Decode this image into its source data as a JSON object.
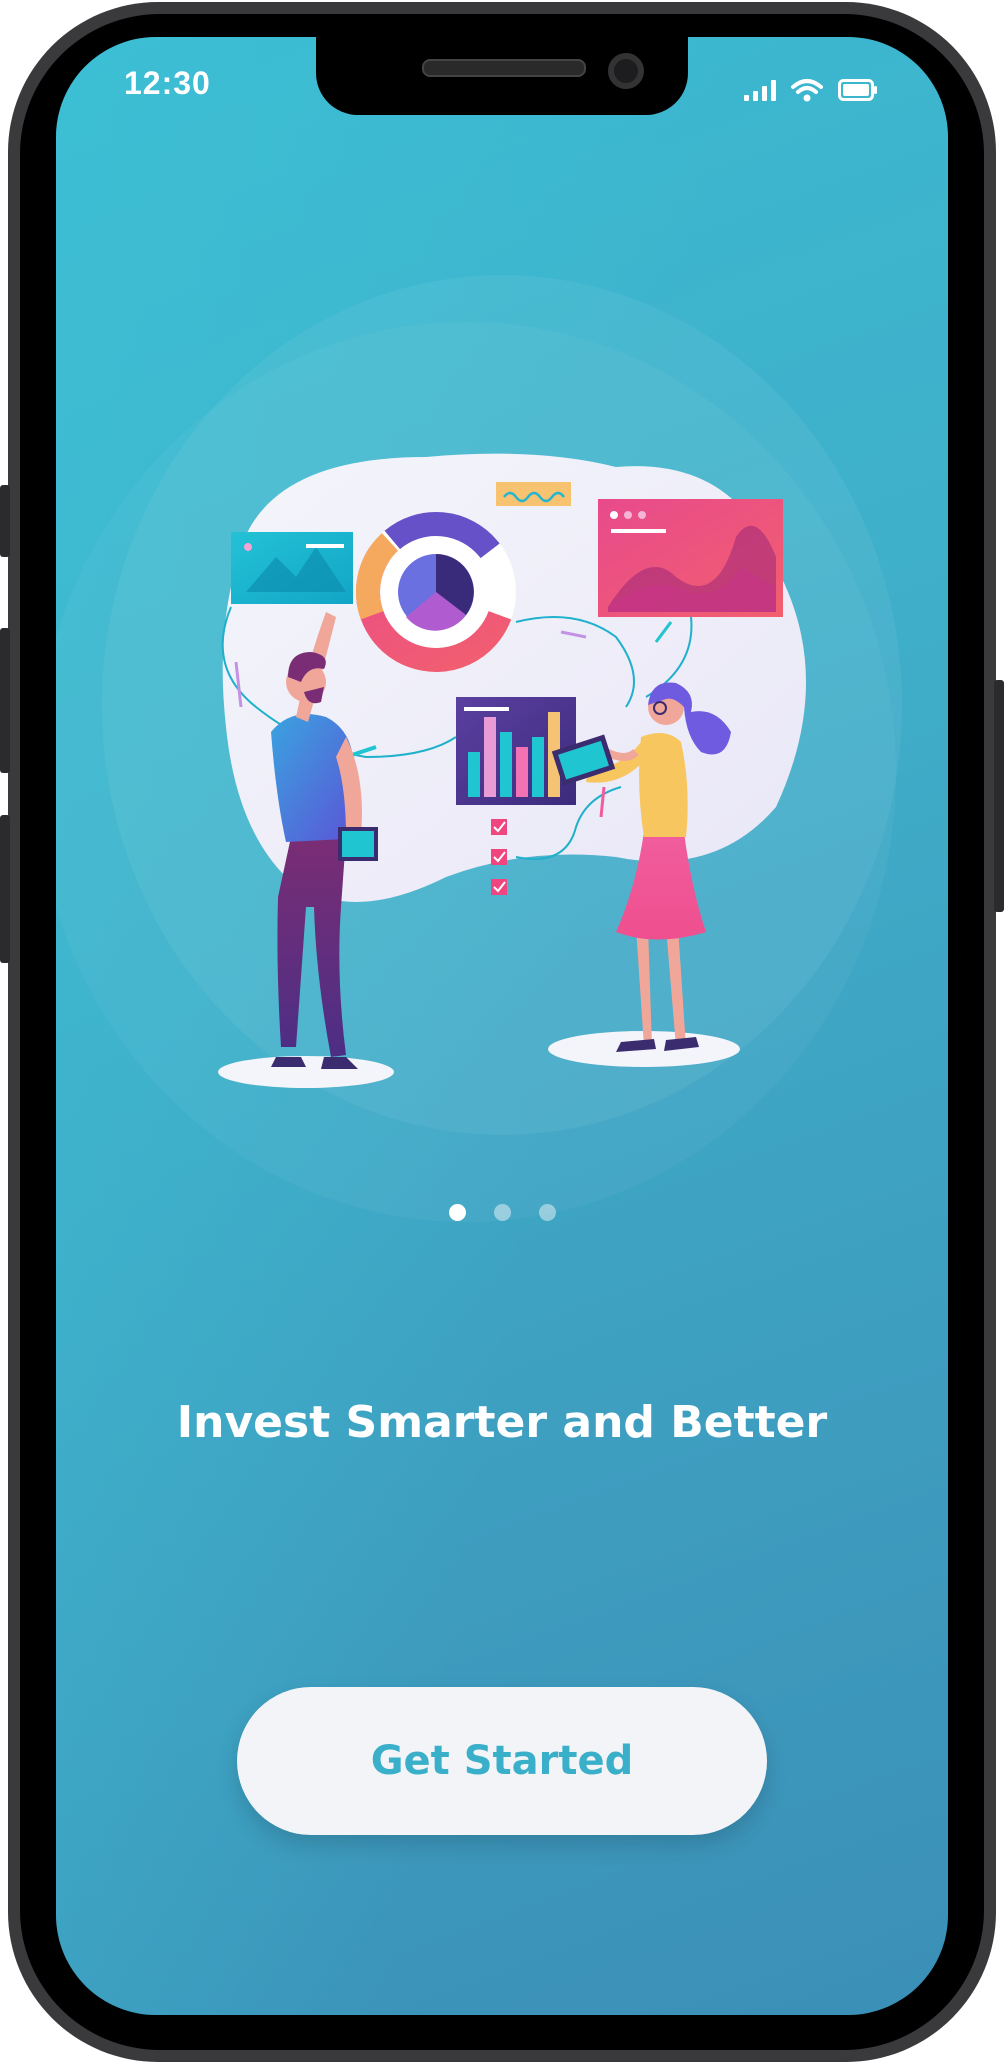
{
  "status_bar": {
    "time": "12:30",
    "icons": [
      "signal-icon",
      "wifi-icon",
      "battery-icon"
    ]
  },
  "onboarding": {
    "illustration": "analytics-illustration",
    "pagination": {
      "total": 3,
      "current": 1
    },
    "headline": "Invest Smarter and Better",
    "cta_label": "Get Started"
  },
  "colors": {
    "background_start": "#3bbad2",
    "background_end": "#3b8fb7",
    "button_bg": "#f3f4f7",
    "button_text": "#3aafc9",
    "accent_pink": "#e8467c",
    "accent_purple": "#5a3fa0"
  }
}
